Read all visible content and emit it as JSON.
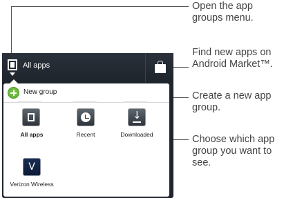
{
  "callouts": [
    {
      "text": "Open the app\ngroups menu."
    },
    {
      "text": "Find new apps on\nAndroid Market™."
    },
    {
      "text": "Create a new app\ngroup."
    },
    {
      "text": "Choose which app\ngroup you want to\nsee."
    }
  ],
  "topbar": {
    "title": "All apps",
    "group_icon": "app-groups-icon",
    "market_icon": "shopping-bag-icon"
  },
  "panel": {
    "new_group_label": "New group",
    "groups": [
      {
        "label": "All apps",
        "icon": "all-apps-icon",
        "selected": true
      },
      {
        "label": "Recent",
        "icon": "clock-icon",
        "selected": false
      },
      {
        "label": "Downloaded",
        "icon": "download-icon",
        "selected": false
      },
      {
        "label": "Verizon Wireless",
        "icon": "verizon-icon",
        "selected": false
      }
    ]
  },
  "colors": {
    "screen_bg": "#1f252e",
    "accent_green": "#6dbb3a",
    "callout_line": "#555555"
  }
}
